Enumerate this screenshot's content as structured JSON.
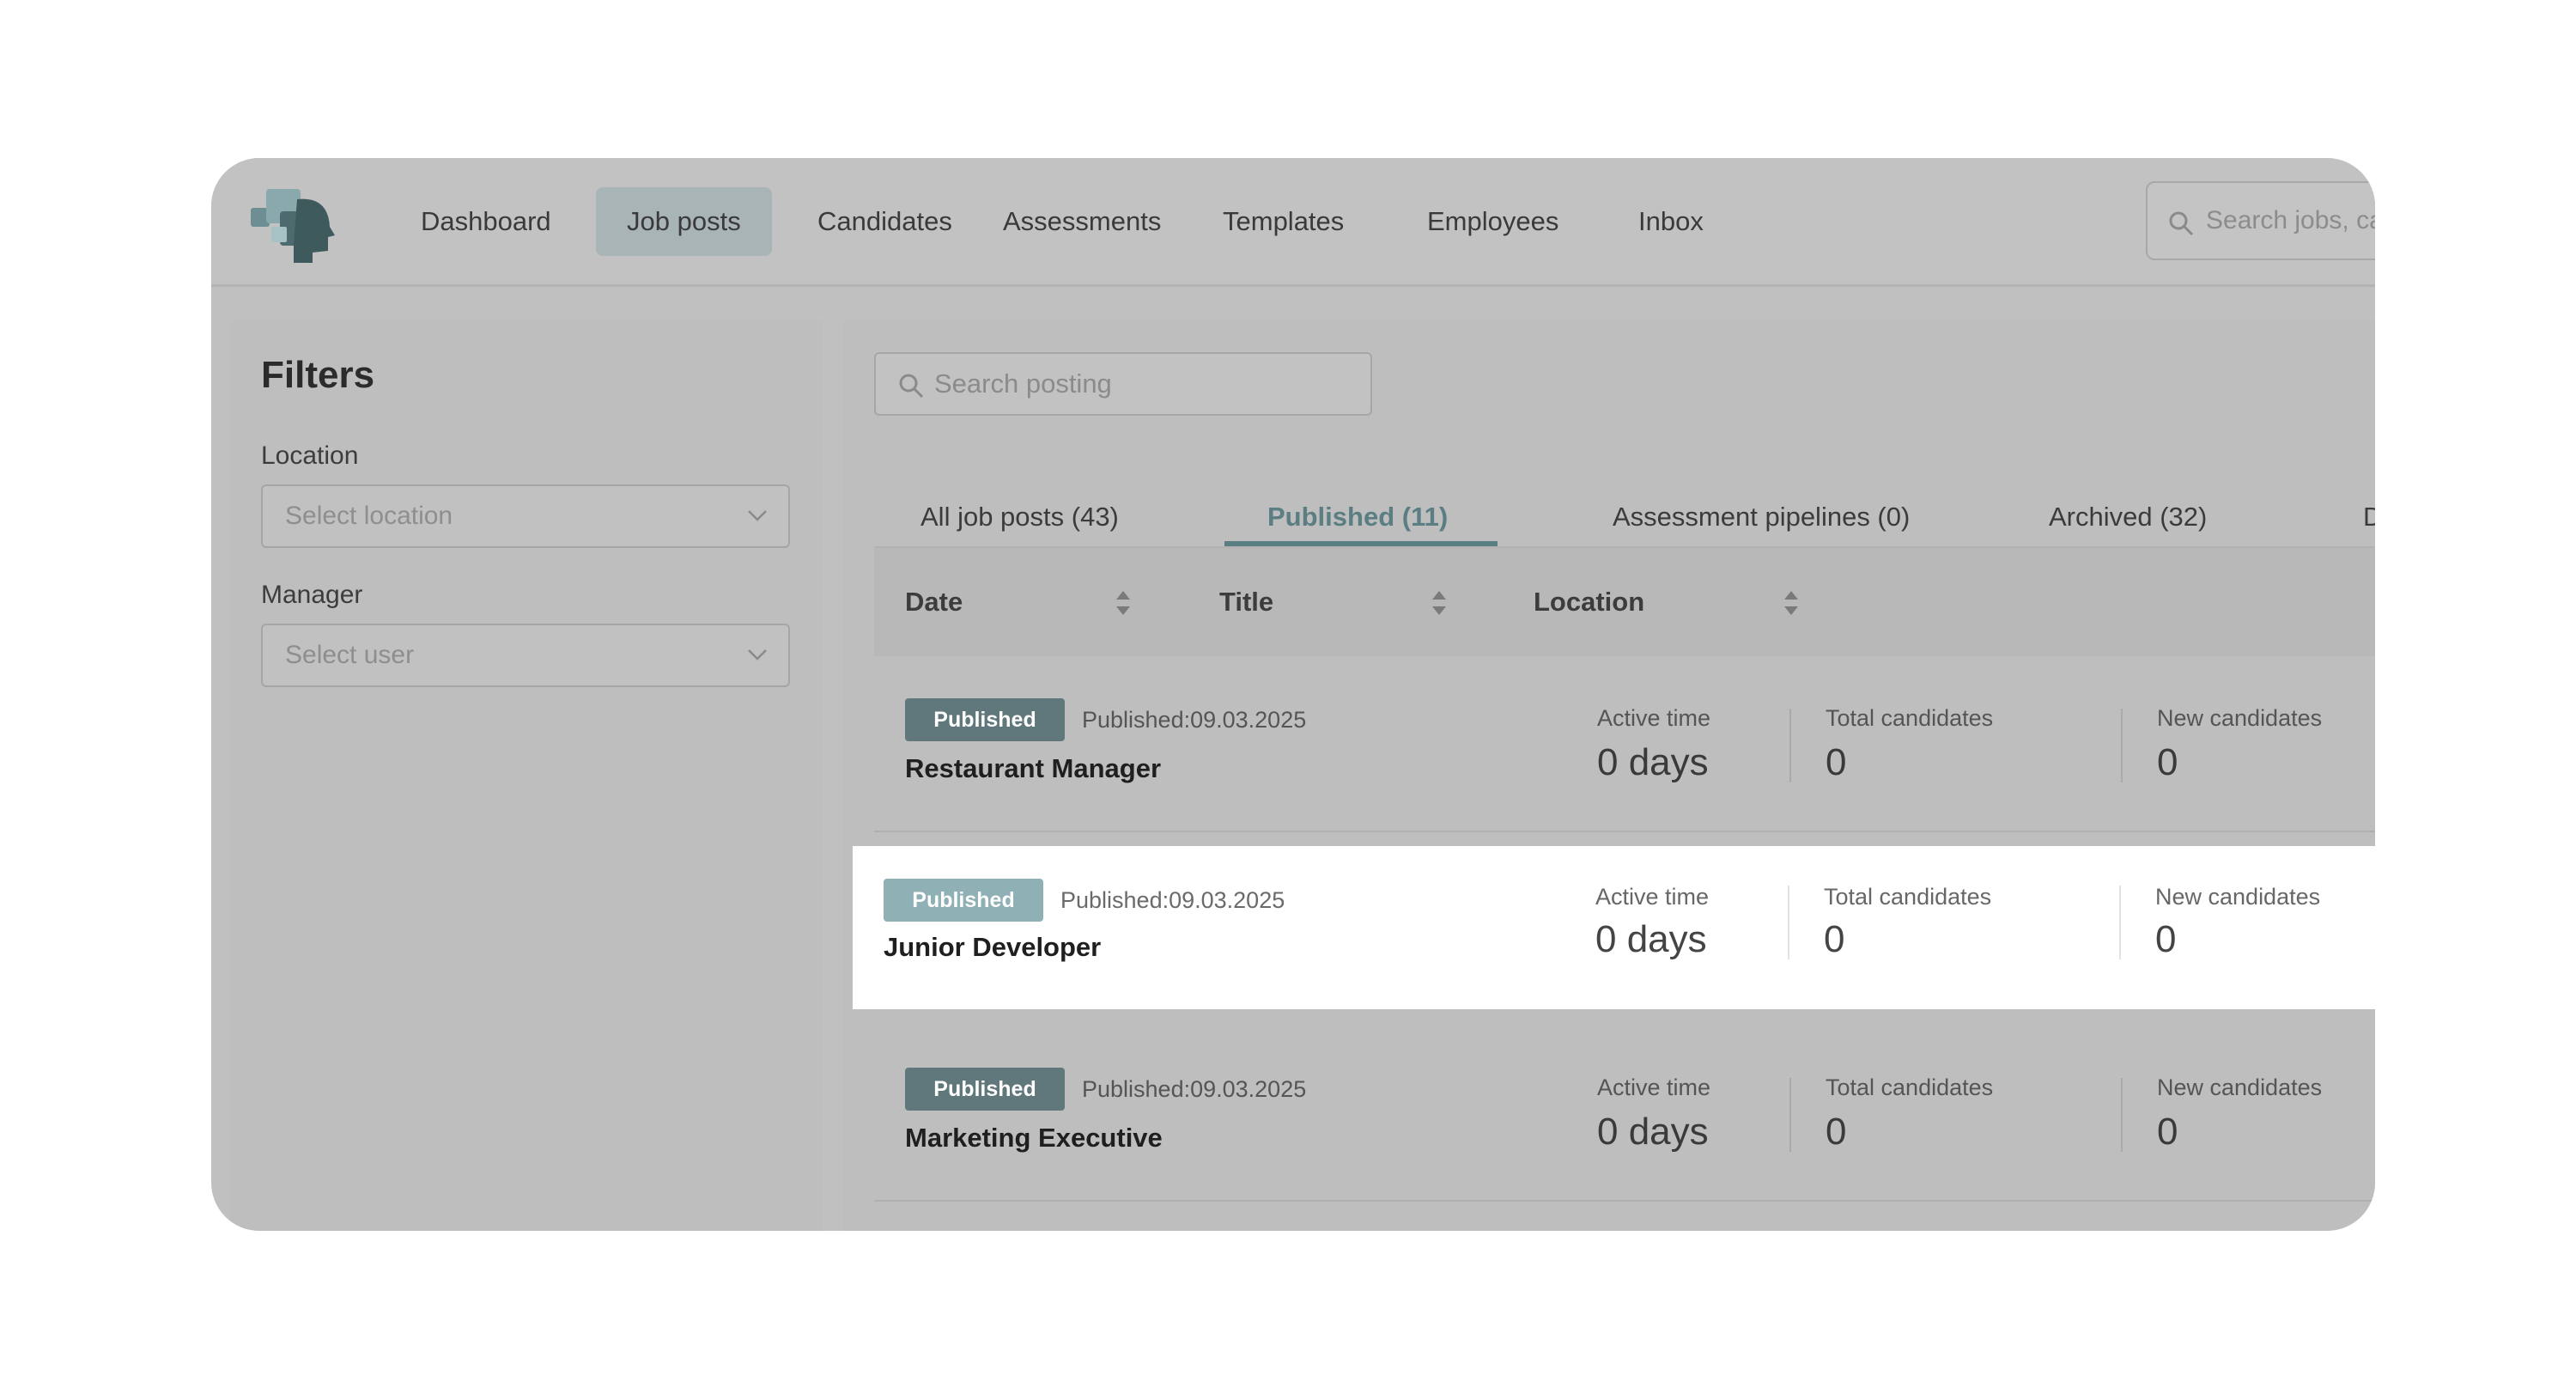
{
  "nav": {
    "items": [
      "Dashboard",
      "Job posts",
      "Candidates",
      "Assessments",
      "Templates",
      "Employees",
      "Inbox"
    ],
    "active": "Job posts",
    "search_placeholder": "Search jobs, ca"
  },
  "filters": {
    "title": "Filters",
    "location": {
      "label": "Location",
      "placeholder": "Select location"
    },
    "manager": {
      "label": "Manager",
      "placeholder": "Select user"
    }
  },
  "posts": {
    "search_placeholder": "Search posting",
    "tabs": [
      "All job posts (43)",
      "Published (11)",
      "Assessment pipelines (0)",
      "Archived (32)",
      "D"
    ],
    "active_tab": "Published (11)",
    "columns": [
      "Date",
      "Title",
      "Location"
    ],
    "stat_labels": {
      "active": "Active time",
      "total": "Total candidates",
      "new": "New candidates"
    },
    "rows": [
      {
        "badge": "Published",
        "published": "Published:09.03.2025",
        "title": "Restaurant Manager",
        "active_time": "0 days",
        "total_candidates": "0",
        "new_candidates": "0"
      },
      {
        "badge": "Published",
        "published": "Published:09.03.2025",
        "title": "Junior Developer",
        "active_time": "0 days",
        "total_candidates": "0",
        "new_candidates": "0"
      },
      {
        "badge": "Published",
        "published": "Published:09.03.2025",
        "title": "Marketing Executive",
        "active_time": "0 days",
        "total_candidates": "0",
        "new_candidates": "0"
      }
    ]
  },
  "colors": {
    "accent": "#5b7e82",
    "badge": "#60787b",
    "overlay": "#c0c0c0"
  }
}
